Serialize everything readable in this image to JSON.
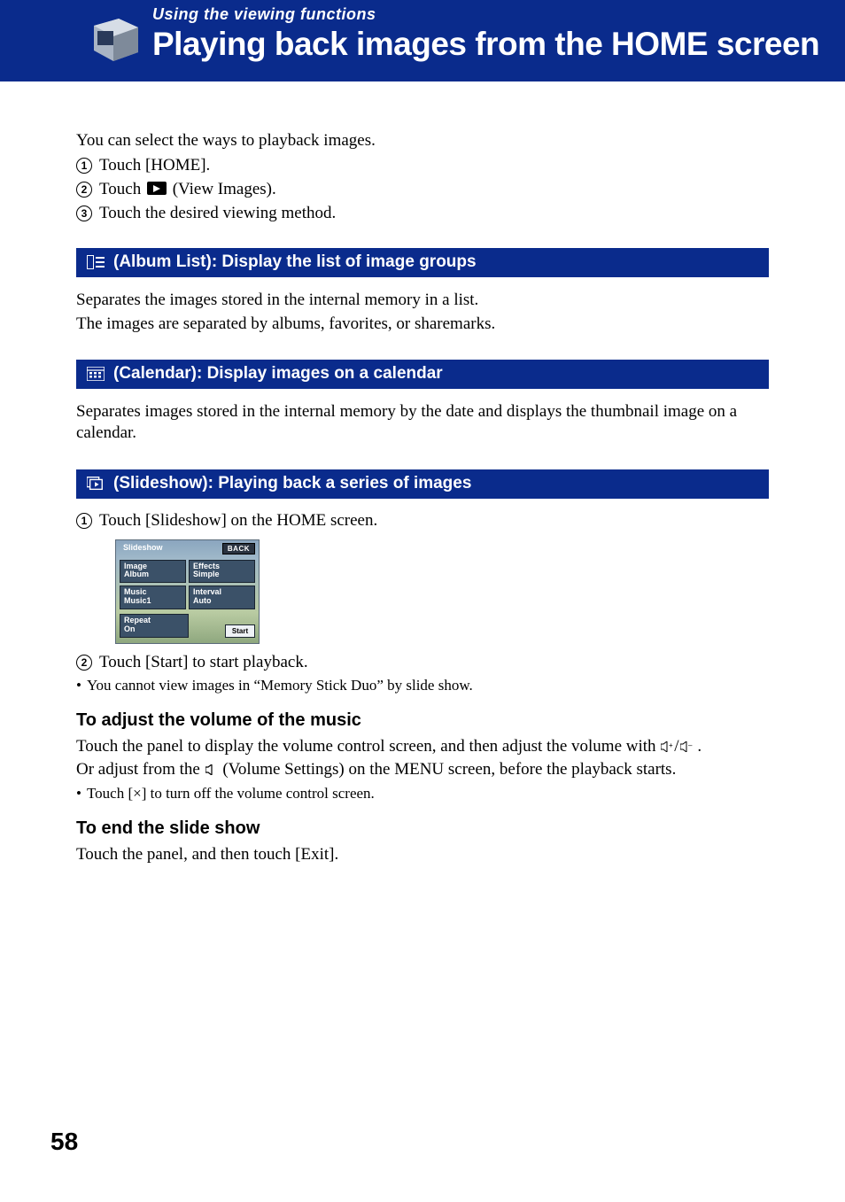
{
  "banner": {
    "category": "Using the viewing functions",
    "title": "Playing back images from the HOME screen"
  },
  "intro": "You can select the ways to playback images.",
  "steps_top": {
    "s1": "Touch [HOME].",
    "s2a": "Touch ",
    "s2b": " (View Images).",
    "s3": "Touch the desired viewing method."
  },
  "sections": {
    "album": {
      "bar": " (Album List): Display the list of image groups",
      "p1": "Separates the images stored in the internal memory in a list.",
      "p2": "The images are separated by albums, favorites, or sharemarks."
    },
    "calendar": {
      "bar": " (Calendar): Display images on a calendar",
      "p1": "Separates images stored in the internal memory by the date and displays the thumbnail image on a calendar."
    },
    "slideshow": {
      "bar": " (Slideshow): Playing back a series of images",
      "step1": "Touch [Slideshow] on the HOME screen.",
      "step2": "Touch [Start] to start playback.",
      "bullet1": "You cannot view images in “Memory Stick Duo” by slide show."
    }
  },
  "slideshow_ui": {
    "title": "Slideshow",
    "back": "BACK",
    "image_lbl": "Image",
    "image_val": "Album",
    "effects_lbl": "Effects",
    "effects_val": "Simple",
    "music_lbl": "Music",
    "music_val": "Music1",
    "interval_lbl": "Interval",
    "interval_val": "Auto",
    "repeat_lbl": "Repeat",
    "repeat_val": "On",
    "start": "Start"
  },
  "volume": {
    "head": "To adjust the volume of the music",
    "p1a": "Touch the panel to display the volume control screen, and then adjust the volume with ",
    "p1b": " .",
    "p2a": "Or adjust from the ",
    "p2b": " (Volume Settings) on the MENU screen, before the playback starts.",
    "bullet": "Touch [×] to turn off the volume control screen."
  },
  "end": {
    "head": "To end the slide show",
    "p": "Touch the panel, and then touch [Exit]."
  },
  "page_number": "58"
}
